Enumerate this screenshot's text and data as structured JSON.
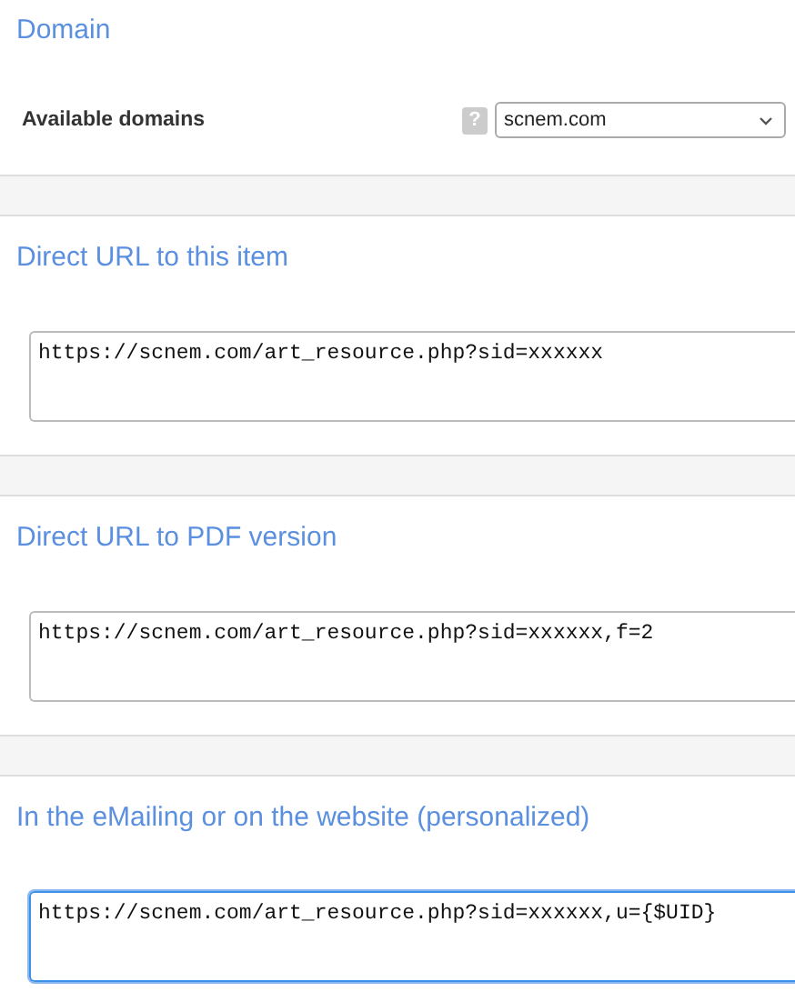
{
  "domain_section": {
    "title": "Domain",
    "field_label": "Available domains",
    "help": "?",
    "select_value": "scnem.com"
  },
  "url_sections": [
    {
      "title": "Direct URL to this item",
      "value": "https://scnem.com/art_resource.php?sid=xxxxxx",
      "focused": false
    },
    {
      "title": "Direct URL to PDF version",
      "value": "https://scnem.com/art_resource.php?sid=xxxxxx,f=2",
      "focused": false
    },
    {
      "title": "In the eMailing or on the website (personalized)",
      "value": "https://scnem.com/art_resource.php?sid=xxxxxx,u={$UID}",
      "focused": true
    }
  ]
}
